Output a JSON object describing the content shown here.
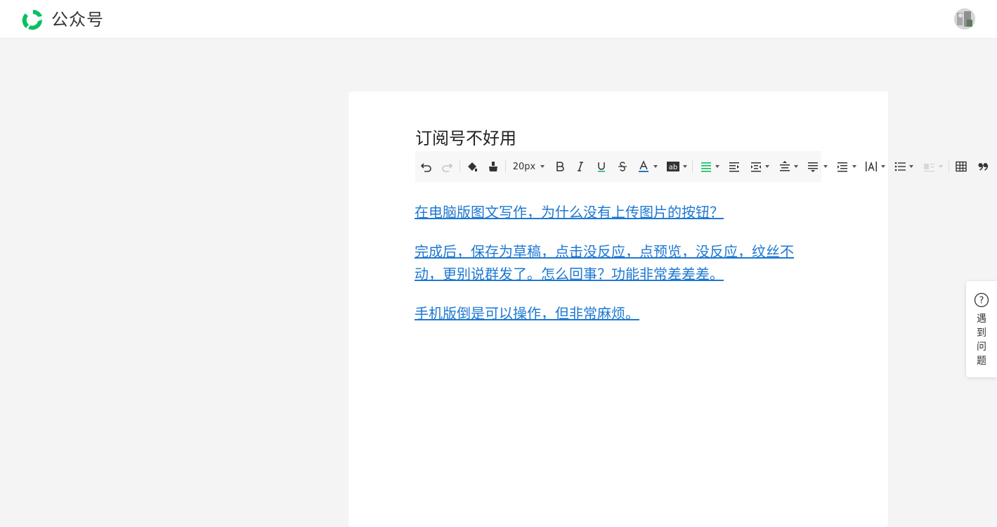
{
  "header": {
    "brand_name": "公众号",
    "logo_icon": "wechat-official-account-logo-icon",
    "avatar_icon": "user-avatar",
    "brand_color": "#07c160"
  },
  "editor": {
    "title": "订阅号不好用",
    "toolbar": {
      "font_size": "20px",
      "items": [
        "undo-icon",
        "redo-icon",
        "format-painter-icon",
        "clear-format-icon",
        "font-size",
        "bold-icon",
        "italic-icon",
        "underline-icon",
        "strikethrough-icon",
        "font-color-icon",
        "background-color-icon",
        "align-icon",
        "indent-icon",
        "paragraph-indent-icon",
        "line-spacing-icon",
        "paragraph-spacing-icon",
        "paragraph-margin-icon",
        "letter-spacing-icon",
        "list-icon",
        "float-icon",
        "table-icon",
        "quote-icon"
      ],
      "accent_color": "#07c160",
      "font_color_underline": "#1e78d2"
    },
    "paragraphs": [
      "在电脑版图文写作，为什么没有上传图片的按钮？",
      "完成后，保存为草稿，点击没反应，点预览，没反应，纹丝不动，更别说群发了。怎么回事？功能非常差差差。",
      "手机版倒是可以操作，但非常麻烦。"
    ],
    "link_color": "#1e78d2"
  },
  "help": {
    "label": "遇到问题",
    "icon": "question-circle-icon"
  }
}
